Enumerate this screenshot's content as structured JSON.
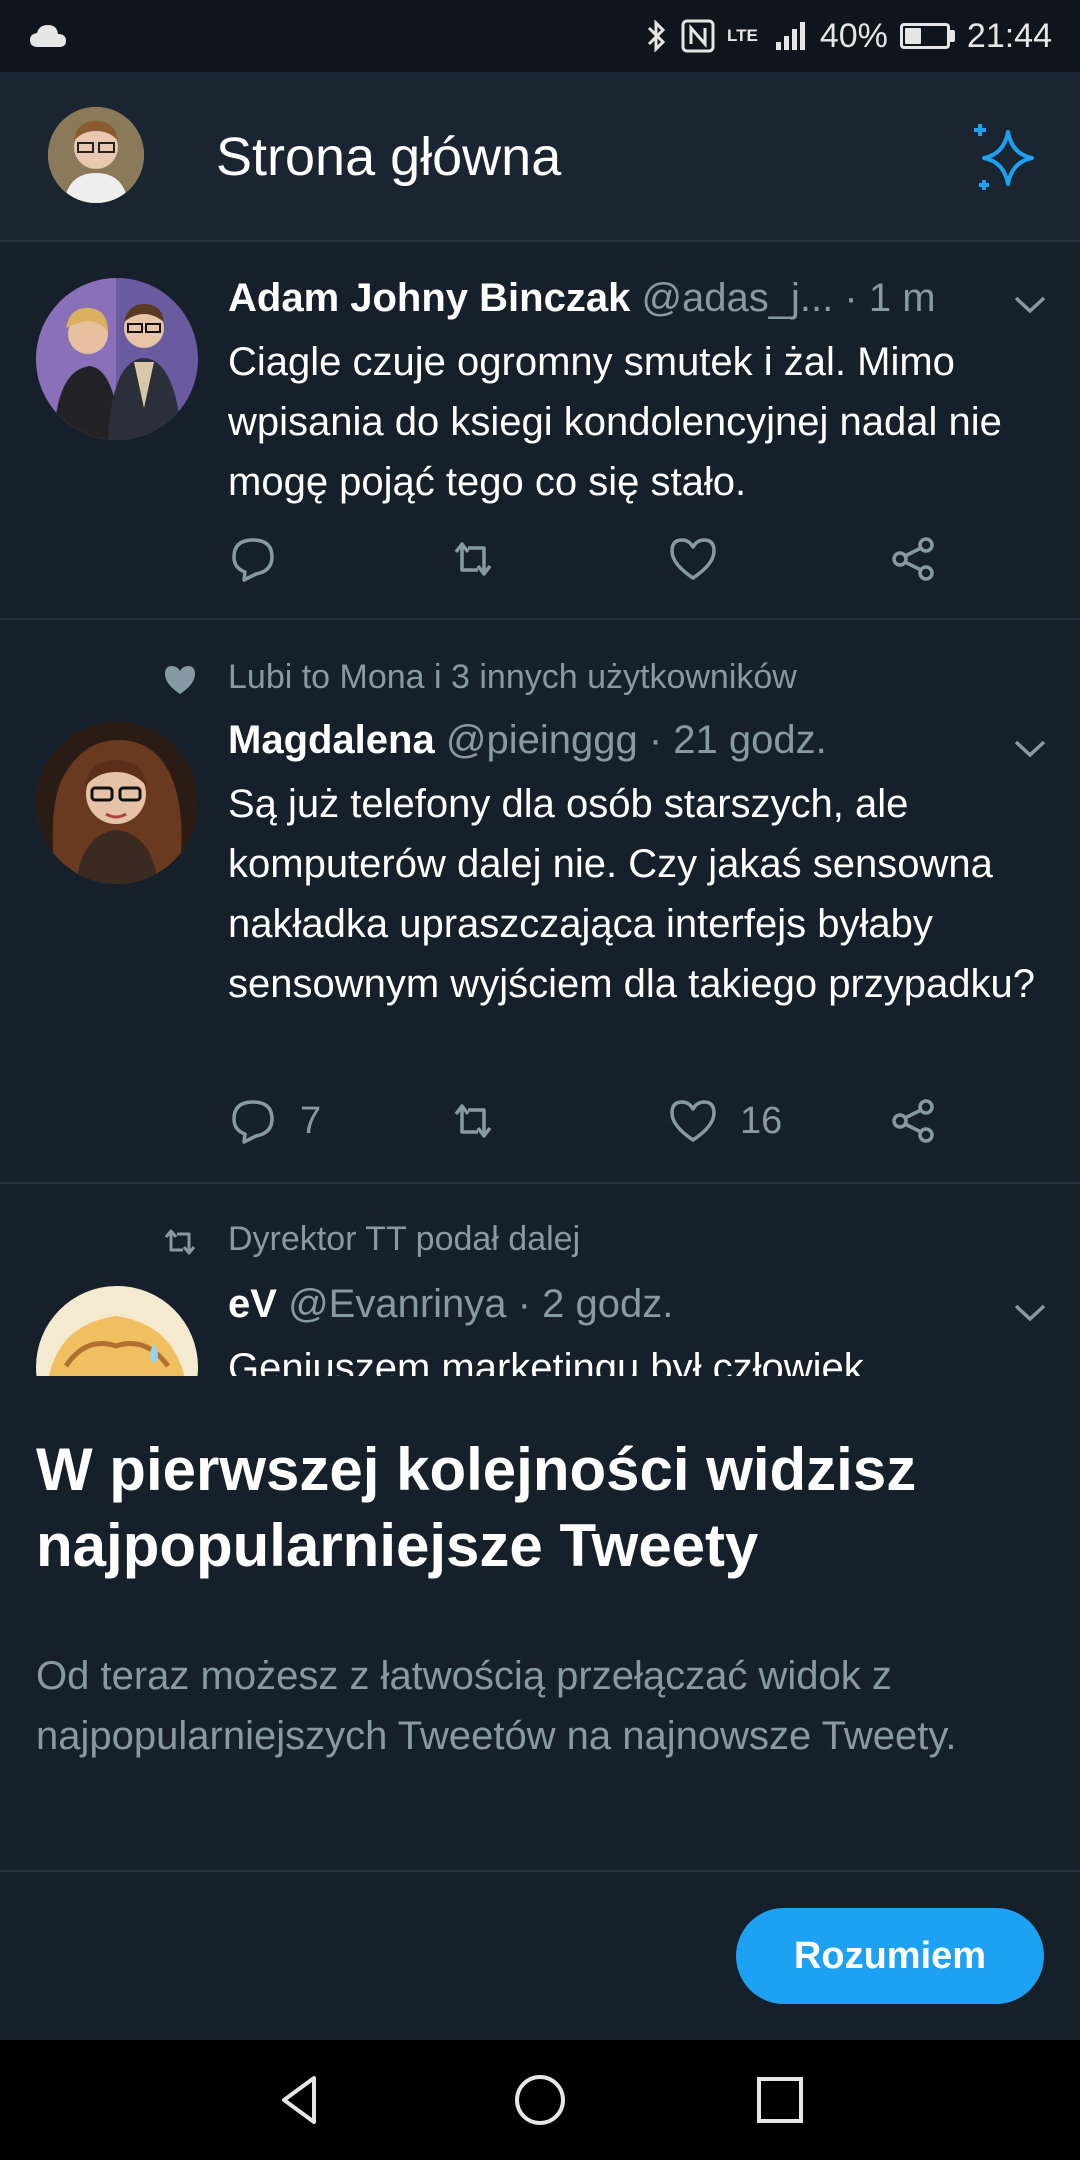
{
  "status_bar": {
    "network": "LTE",
    "battery": "40%",
    "battery_level": 0.4,
    "time": "21:44"
  },
  "header": {
    "title": "Strona główna",
    "avatar_icon": "profile-avatar",
    "action_icon": "sparkle-icon"
  },
  "tweets": [
    {
      "name": "Adam Johny Binczak",
      "handle": "@adas_j...",
      "time": "· 1 m",
      "text": "Ciagle czuje ogromny smutek i żal. Mimo wpisania do ksiegi kondolencyjnej nadal nie mogę pojąć tego co się stało.",
      "replies": "",
      "likes": ""
    },
    {
      "context": "Lubi to Mona i 3 innych użytkowników",
      "name": "Magdalena",
      "handle": "@pieinggg",
      "time": "· 21 godz.",
      "text": "Są już telefony dla osób starszych, ale komputerów dalej nie. Czy jakaś sensowna nakładka upraszczająca interfejs byłaby sensownym wyjściem dla takiego przypadku?",
      "replies": "7",
      "likes": "16"
    },
    {
      "context": "Dyrektor TT podał dalej",
      "name": "eV",
      "handle": "@Evanrinya",
      "time": "· 2 godz.",
      "text": "Geniuszem marketingu był człowiek,"
    }
  ],
  "sheet": {
    "title": "W pierwszej kolejności widzisz najpopularniejsze Tweety",
    "body": "Od teraz możesz z łatwością przełączać widok z najpopularniejszych Tweetów na najnowsze Tweety.",
    "button": "Rozumiem"
  },
  "colors": {
    "background": "#15202b",
    "accent": "#1da1f2",
    "muted": "#8899a6"
  }
}
